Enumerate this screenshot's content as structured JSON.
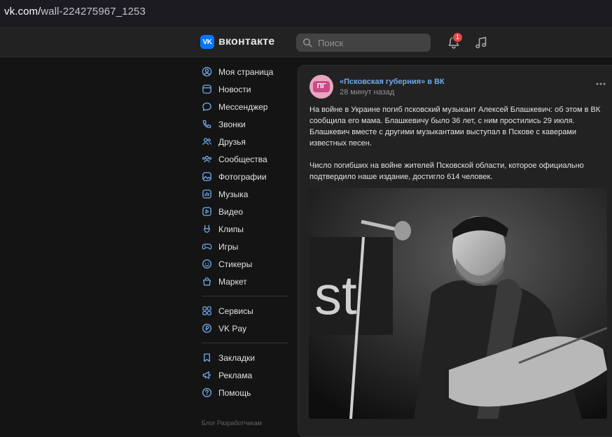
{
  "browser": {
    "url_host": "vk.com/",
    "url_path": "wall-224275967_1253"
  },
  "header": {
    "logo_text": "вконтакте",
    "logo_mark": "VK",
    "search_placeholder": "Поиск",
    "notification_count": "1",
    "icons": [
      "search-icon",
      "bell-icon",
      "music-icon"
    ]
  },
  "sidebar": {
    "items": [
      {
        "label": "Моя страница",
        "icon": "profile-icon"
      },
      {
        "label": "Новости",
        "icon": "news-icon"
      },
      {
        "label": "Мессенджер",
        "icon": "messenger-icon"
      },
      {
        "label": "Звонки",
        "icon": "phone-icon"
      },
      {
        "label": "Друзья",
        "icon": "friends-icon"
      },
      {
        "label": "Сообщества",
        "icon": "communities-icon"
      },
      {
        "label": "Фотографии",
        "icon": "photos-icon"
      },
      {
        "label": "Музыка",
        "icon": "music-icon"
      },
      {
        "label": "Видео",
        "icon": "video-icon"
      },
      {
        "label": "Клипы",
        "icon": "clips-icon"
      },
      {
        "label": "Игры",
        "icon": "games-icon"
      },
      {
        "label": "Стикеры",
        "icon": "stickers-icon"
      },
      {
        "label": "Маркет",
        "icon": "market-icon"
      }
    ],
    "items2": [
      {
        "label": "Сервисы",
        "icon": "services-icon"
      },
      {
        "label": "VK Pay",
        "icon": "vkpay-icon"
      }
    ],
    "items3": [
      {
        "label": "Закладки",
        "icon": "bookmarks-icon"
      },
      {
        "label": "Реклама",
        "icon": "ads-icon"
      },
      {
        "label": "Помощь",
        "icon": "help-icon"
      }
    ],
    "footer": "Блог   Разработчикам"
  },
  "post": {
    "avatar_text": "ПГ",
    "author": "«Псковская губерния» в ВК",
    "time": "28 минут назад",
    "paragraph1": "На войне в Украине погиб псковский музыкант Алексей Блашкевич: об этом в ВК\nсообщила его мама. Блашкевичу было 36 лет, с ним простились 29 июля.\nБлашкевич вместе с другими музыкантами выступал в Пскове с каверами\nизвестных песен.",
    "paragraph2": "Число погибших на войне жителей Псковской области, которое официально\nподтвердило наше издание, достигло 614 человек.",
    "photo_letters": "st"
  },
  "colors": {
    "accent": "#71aaeb",
    "brand": "#0077ff",
    "badge": "#e64646"
  }
}
